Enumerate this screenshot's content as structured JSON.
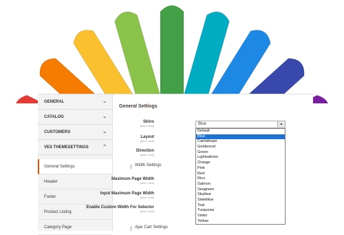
{
  "sidebar": {
    "items": [
      {
        "label": "GENERAL"
      },
      {
        "label": "CATALOG"
      },
      {
        "label": "CUSTOMERS"
      },
      {
        "label": "VES THEMESETTINGS"
      }
    ],
    "subitems": [
      {
        "label": "General Settings"
      },
      {
        "label": "Header"
      },
      {
        "label": "Footer"
      },
      {
        "label": "Product Listing"
      },
      {
        "label": "Category Page"
      }
    ]
  },
  "main": {
    "title": "General Settings",
    "skins_label": "Skins",
    "layout_label": "Layout",
    "direction_label": "Direction",
    "scope": "[store view]",
    "width_section": "Width Settings",
    "max_width_label": "Maximum Page Width",
    "input_max_width_label": "Input Maximum Page Width",
    "custom_width_label": "Enable Custom Width For Selector",
    "ajax_section": "Ajax Cart Settings"
  },
  "skins_select": {
    "value": "Blue",
    "options": [
      "Default",
      "Blue",
      "Cantaloupe",
      "Goldenrod",
      "Green",
      "Lightsalmon",
      "Orange",
      "Pink",
      "Red",
      "Rico",
      "Salmon",
      "Seagreen",
      "Skyblue",
      "Slateblue",
      "Teal",
      "Turquoise",
      "Violet",
      "Yellow"
    ]
  },
  "fan_colors": [
    "#c8102e",
    "#e53935",
    "#f57c00",
    "#fbc02d",
    "#8bc34a",
    "#43a047",
    "#00acc1",
    "#1e88e5",
    "#3949ab",
    "#7b1fa2",
    "#ad1457"
  ]
}
